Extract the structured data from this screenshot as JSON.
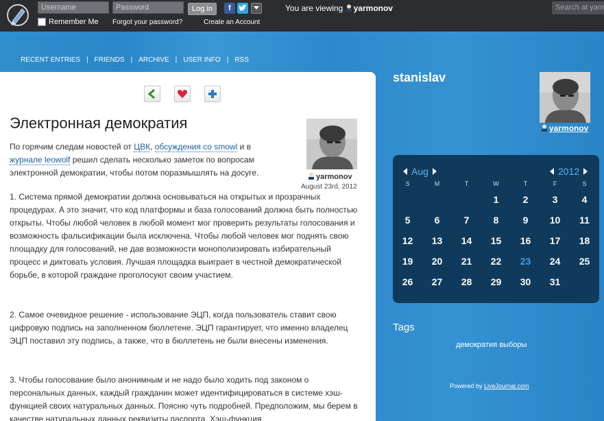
{
  "topbar": {
    "username_placeholder": "Username",
    "password_placeholder": "Password",
    "login_label": "Log in",
    "remember_label": "Remember Me",
    "forgot_label": "Forgot your password?",
    "create_label": "Create an Account",
    "viewing_prefix": "You are viewing",
    "viewing_user": "yarmonov",
    "search_placeholder": "Search at yarmonov"
  },
  "nav": {
    "items": [
      "RECENT ENTRIES",
      "FRIENDS",
      "ARCHIVE",
      "USER INFO",
      "RSS"
    ],
    "separator": "|"
  },
  "post": {
    "title": "Электронная демократия",
    "user": "yarmonov",
    "date": "August 23rd, 2012",
    "intro_1": "По горячим следам новостей от ",
    "link_cvk": "ЦВК",
    "intro_2": ", ",
    "link_discussion": "обсуждения со smowl",
    "intro_3": " и в ",
    "link_journal": "журнале leowolf",
    "intro_4": " решил сделать несколько заметок по вопросам электронной демократии, чтобы потом поразмышлять на досуге.",
    "p1": "1. Система прямой демократии должна основываться на открытых и прозрачных процедурах. А это значит, что код платформы и база голосований должна быть полностью открыты. Чтобы любой человек в любой момент мог проверить результаты голосования и возможность фальсификации была исключена. Чтобы любой человек мог поднять свою площадку для голосований, не дав возможности монополизировать избирательный процесс и диктовать условия. Лучшая площадка выиграет в честной демократической борьбе, в которой граждане проголосуют своим участием.",
    "p2": "2. Самое очевидное решение - использование ЭЦП, когда пользователь ставит свою цифровую подпись на заполненном бюллетене. ЭЦП гарантирует, что именно владелец ЭЦП поставил эту подпись, а также, что в бюллетень не были внесены изменения.",
    "p3": "3. Чтобы голосование было анонимным и не надо было ходить под законом о персональных данных, каждый гражданин может идентифицироваться в системе хэш-функцией своих натуральных данных. Поясню чуть подробней. Предположим, мы берем в качестве натуральных данных реквизиты паспорта. Хэш-функция"
  },
  "sidebar": {
    "journal_name": "stanislav",
    "user": "yarmonov",
    "calendar": {
      "month": "Aug",
      "year": "2012",
      "weekdays": [
        "S",
        "M",
        "T",
        "W",
        "T",
        "F",
        "S"
      ],
      "weeks": [
        [
          "",
          "",
          "",
          "1",
          "2",
          "3",
          "4"
        ],
        [
          "5",
          "6",
          "7",
          "8",
          "9",
          "10",
          "11"
        ],
        [
          "12",
          "13",
          "14",
          "15",
          "16",
          "17",
          "18"
        ],
        [
          "19",
          "20",
          "21",
          "22",
          "23",
          "24",
          "25"
        ],
        [
          "26",
          "27",
          "28",
          "29",
          "30",
          "31",
          ""
        ]
      ],
      "highlighted_day": "23"
    },
    "tags_label": "Tags",
    "tags": "демократия выборы",
    "powered_prefix": "Powered by ",
    "powered_link": "LiveJournal.com"
  },
  "colors": {
    "topbar_bg": "#2b2d31",
    "page_bg": "#2f8fce",
    "calendar_bg": "#0f3a5c",
    "link": "#1a5fa3",
    "highlight_day": "#3aa0e6"
  }
}
